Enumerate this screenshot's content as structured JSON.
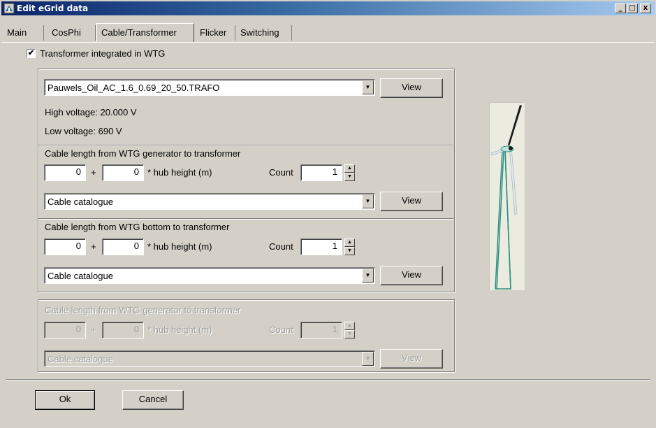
{
  "window": {
    "title": "Edit eGrid data",
    "controls": {
      "minimize": "_",
      "maximize": "□",
      "close": "x"
    }
  },
  "tabs": [
    {
      "label": "Main"
    },
    {
      "label": "CosPhi"
    },
    {
      "label": "Cable/Transformer",
      "active": true
    },
    {
      "label": "Flicker"
    },
    {
      "label": "Switching"
    }
  ],
  "transformer": {
    "checkbox_label": "Transformer integrated in WTG",
    "checked": true,
    "checkmark": "✔",
    "selected": "Pauwels_Oil_AC_1.6_0.69_20_50.TRAFO",
    "view_label": "View",
    "high_voltage": "High voltage: 20.000 V",
    "low_voltage": "Low voltage: 690 V"
  },
  "cable_generator": {
    "title": "Cable length from WTG generator to transformer",
    "value1": "0",
    "plus": "+",
    "value2": "0",
    "hub_label": "* hub height (m)",
    "count_label": "Count",
    "count": "1",
    "catalogue": "Cable catalogue",
    "view_label": "View"
  },
  "cable_bottom": {
    "title": "Cable length from WTG bottom to transformer",
    "value1": "0",
    "plus": "+",
    "value2": "0",
    "hub_label": "* hub height (m)",
    "count_label": "Count",
    "count": "1",
    "catalogue": "Cable catalogue",
    "view_label": "View"
  },
  "cable_disabled": {
    "title": "Cable length from WTG generator to transformer",
    "value1": "0",
    "plus": "+",
    "value2": "0",
    "hub_label": "* hub height (m)",
    "count_label": "Count",
    "count": "1",
    "catalogue": "Cable catalogue",
    "view_label": "View"
  },
  "footer": {
    "ok_label": "Ok",
    "cancel_label": "Cancel"
  },
  "colors": {
    "titlebar_start": "#0a246a",
    "titlebar_end": "#a6caf0",
    "face": "#d4d0c8"
  }
}
